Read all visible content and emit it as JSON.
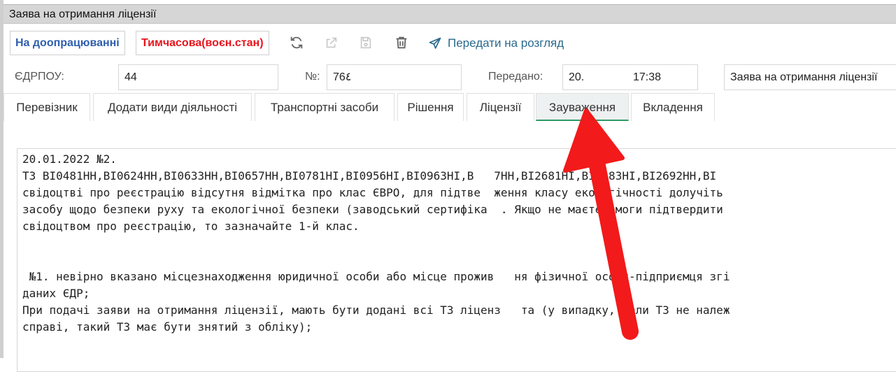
{
  "window": {
    "title": "Заява на отримання ліцензії"
  },
  "toolbar": {
    "status_button": "На доопрацюванні",
    "type_button": "Тимчасова(воєн.стан)",
    "send_label": "Передати на розгляд",
    "icons": [
      "refresh-icon",
      "external-link-icon",
      "save-icon",
      "trash-icon",
      "send-icon"
    ]
  },
  "fields": {
    "edrpou": {
      "label": "ЄДРПОУ:",
      "value": "44"
    },
    "number": {
      "label": "№:",
      "value": "76٤"
    },
    "sent": {
      "label": "Передано:",
      "date": "20.",
      "time": "17:38"
    },
    "doctype": {
      "value": "Заява на отримання ліцензії"
    }
  },
  "tabs": [
    {
      "label": "Перевізник"
    },
    {
      "label": "Додати види діяльності"
    },
    {
      "label": "Транспортні засоби"
    },
    {
      "label": "Рішення"
    },
    {
      "label": "Ліцензії"
    },
    {
      "label": "Зауваження"
    },
    {
      "label": "Вкладення"
    }
  ],
  "active_tab": "Зауваження",
  "remarks": {
    "lines": [
      "20.01.2022 №2.",
      "ТЗ BI0481HH,BI0624HH,BI0633HH,BI0657HH,BI0781HI,BI0956HI,BI0963HI,B   7HH,BI2681HI,BI2683HI,BI2692HH,BI",
      "свідоцтві про реєстрацію відсутня відмітка про клас ЄВРО, для підтве  ження класу екологічності долучіть",
      "засобу щодо безпеки руху та екологічної безпеки (заводський сертифіка  . Якщо не маєте змоги підтвердити",
      "свідоцтвом про реєстрацію, то зазначайте 1-й клас.",
      "",
      "",
      " №1. невірно вказано місцезнаходження юридичної особи або місце прожив   ня фізичної особи-підприємця згі",
      "даних ЄДР;",
      "При подачі заяви на отримання ліцензії, мають бути додані всі ТЗ ліценз   та (у випадку, коли ТЗ не належ",
      "справі, такий ТЗ має бути знятий з обліку);"
    ]
  },
  "colors": {
    "accent_blue": "#2e5fae",
    "warning_red": "#e8141d",
    "active_tab_underline": "#2c9a64",
    "arrow": "#f21a1a"
  }
}
